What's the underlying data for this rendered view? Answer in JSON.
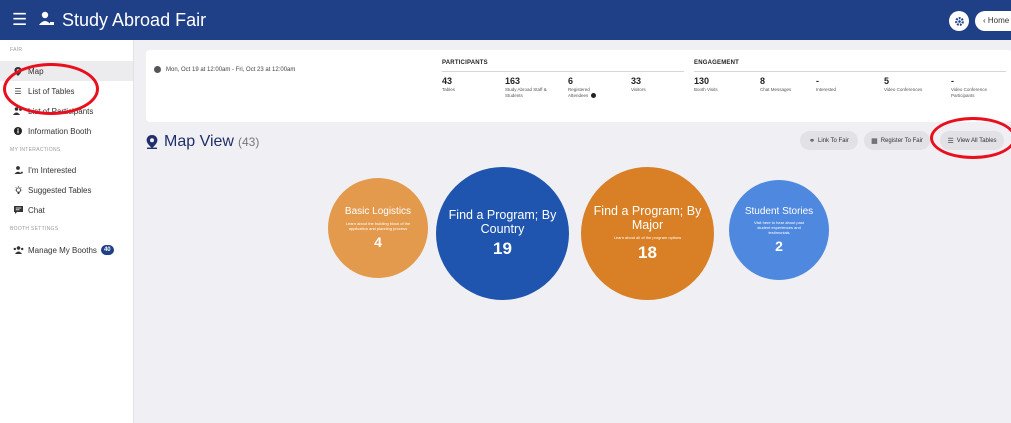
{
  "header": {
    "title": "Study Abroad Fair",
    "home_label": "‹ Home",
    "bg_color": "#1f3f87"
  },
  "sidebar": {
    "section_fair": "FAIR",
    "section_interactions": "MY INTERACTIONS",
    "section_booth": "BOOTH SETTINGS",
    "items": [
      {
        "id": "map",
        "label": "Map",
        "icon": "map-pin-icon",
        "active": true
      },
      {
        "id": "list-of-tables",
        "label": "List of Tables",
        "icon": "list-icon"
      },
      {
        "id": "list-of-participants",
        "label": "List of Participants",
        "icon": "people-icon"
      },
      {
        "id": "information-booth",
        "label": "Information Booth",
        "icon": "info-icon"
      },
      {
        "id": "im-interested",
        "label": "I'm Interested",
        "icon": "person-icon"
      },
      {
        "id": "suggested-tables",
        "label": "Suggested Tables",
        "icon": "lightbulb-icon"
      },
      {
        "id": "chat",
        "label": "Chat",
        "icon": "chat-icon"
      },
      {
        "id": "manage-my-booths",
        "label": "Manage My Booths",
        "icon": "group-icon",
        "badge": "40"
      }
    ]
  },
  "summary": {
    "date_range": "Mon, Oct 19 at 12:00am - Fri, Oct 23 at 12:00am",
    "participants_heading": "PARTICIPANTS",
    "engagement_heading": "ENGAGEMENT",
    "participants": [
      {
        "value": "43",
        "label": "Tables"
      },
      {
        "value": "163",
        "label": "Study Abroad Staff & Students"
      },
      {
        "value": "6",
        "label": "Registered Attendees"
      },
      {
        "value": "33",
        "label": "Visitors"
      }
    ],
    "engagement": [
      {
        "value": "130",
        "label": "Booth Visits"
      },
      {
        "value": "8",
        "label": "Chat Messages"
      },
      {
        "value": "-",
        "label": "Interested"
      },
      {
        "value": "5",
        "label": "Video Conferences"
      },
      {
        "value": "-",
        "label": "Video Conference Participants"
      }
    ]
  },
  "map": {
    "title": "Map View",
    "count": "(43)",
    "buttons": {
      "link": "Link To Fair",
      "register": "Register To Fair",
      "view_all": "View All Tables"
    },
    "bubbles": [
      {
        "title": "Basic Logistics",
        "desc": "Learn about the building block of the application and planning process",
        "count": "4",
        "color": "#e49a4c"
      },
      {
        "title": "Find a Program; By Country",
        "desc": "",
        "count": "19",
        "color": "#1f55ae"
      },
      {
        "title": "Find a Program; By Major",
        "desc": "Learn about all of the program options",
        "count": "18",
        "color": "#d97f25"
      },
      {
        "title": "Student Stories",
        "desc": "Visit here to hear about past student experiences and testimonials",
        "count": "2",
        "color": "#4f88df"
      }
    ]
  },
  "annotation_color": "#e8101d"
}
